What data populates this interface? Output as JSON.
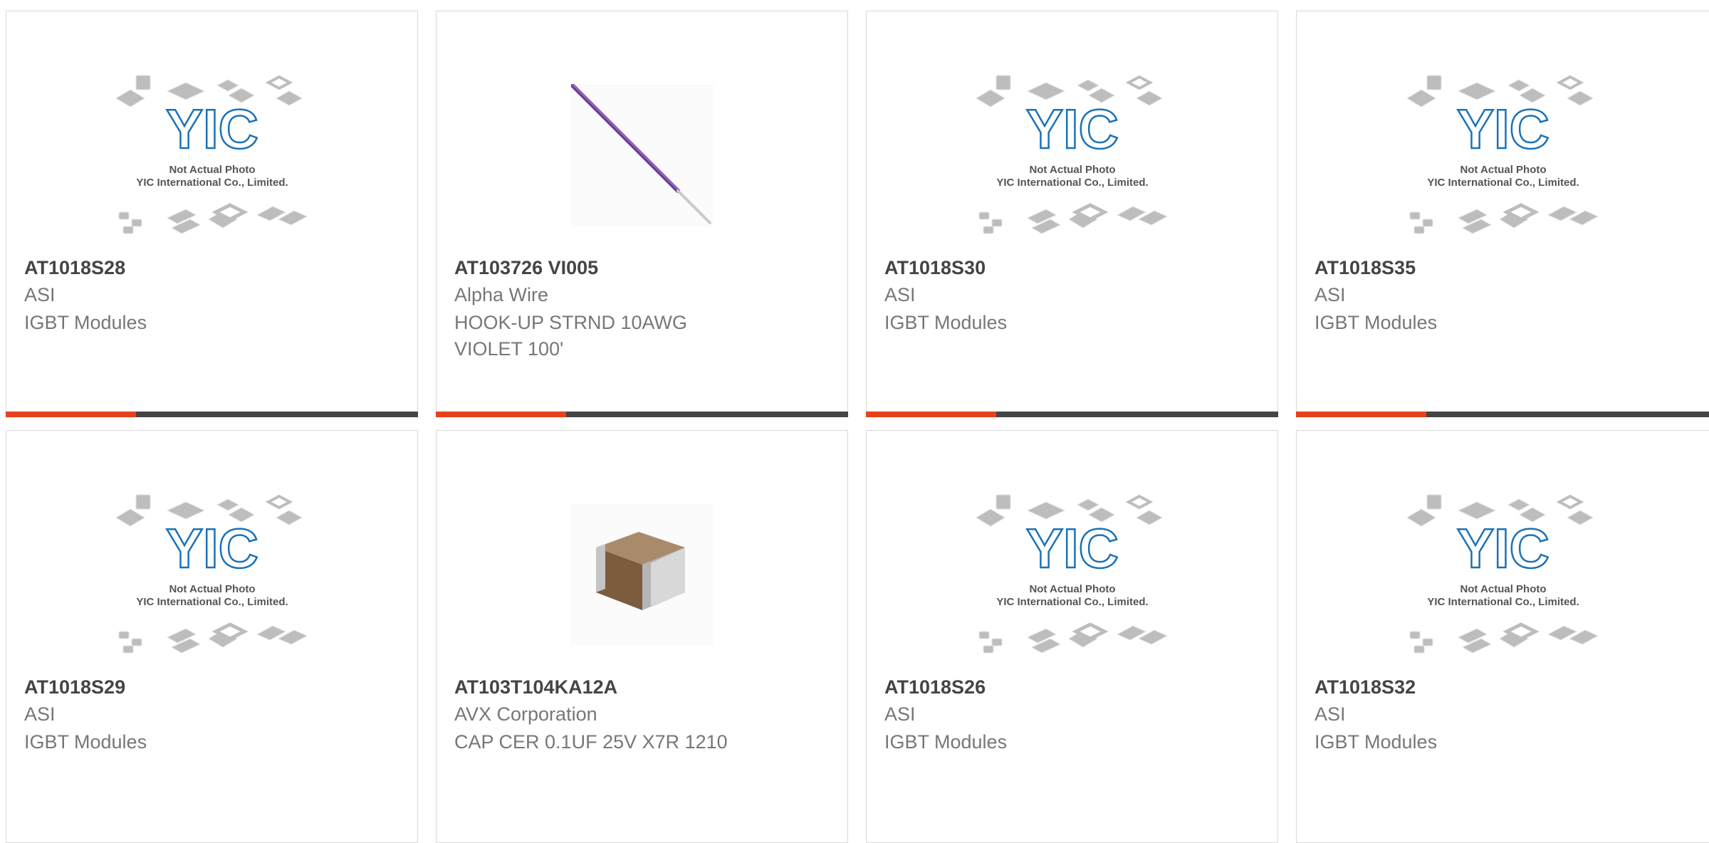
{
  "colors": {
    "accent": "#e8401c",
    "bar": "#444444",
    "logo_blue": "#1a72b8"
  },
  "placeholder": {
    "logo_text": "YIC",
    "line1": "Not Actual Photo",
    "line2": "YIC International Co., Limited."
  },
  "products": [
    {
      "pn": "AT1018S28",
      "mfr": "ASI",
      "desc": "IGBT Modules",
      "image": "placeholder"
    },
    {
      "pn": "AT103726 VI005",
      "mfr": "Alpha Wire",
      "desc": "HOOK-UP STRND 10AWG VIOLET 100'",
      "image": "wire"
    },
    {
      "pn": "AT1018S30",
      "mfr": "ASI",
      "desc": "IGBT Modules",
      "image": "placeholder"
    },
    {
      "pn": "AT1018S35",
      "mfr": "ASI",
      "desc": "IGBT Modules",
      "image": "placeholder"
    },
    {
      "pn": "AT1018S29",
      "mfr": "ASI",
      "desc": "IGBT Modules",
      "image": "placeholder"
    },
    {
      "pn": "AT103T104KA12A",
      "mfr": "AVX Corporation",
      "desc": "CAP CER 0.1UF 25V X7R 1210",
      "image": "capacitor"
    },
    {
      "pn": "AT1018S26",
      "mfr": "ASI",
      "desc": "IGBT Modules",
      "image": "placeholder"
    },
    {
      "pn": "AT1018S32",
      "mfr": "ASI",
      "desc": "IGBT Modules",
      "image": "placeholder"
    }
  ]
}
